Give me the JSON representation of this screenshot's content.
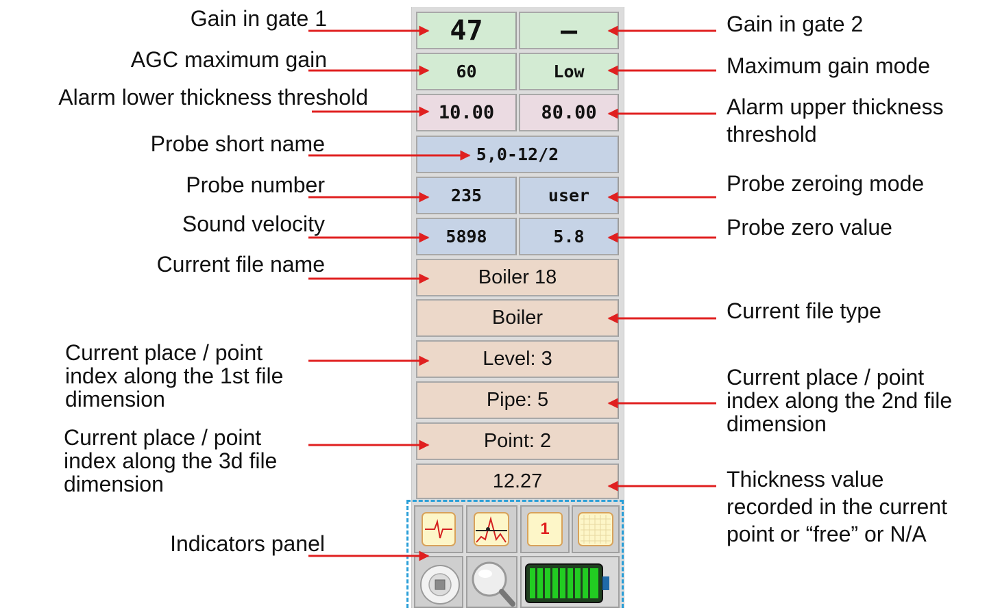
{
  "labels": {
    "gain_gate1": "Gain in gate 1",
    "agc_max_gain": "AGC maximum gain",
    "alarm_lower": "Alarm lower thickness threshold",
    "probe_short_name": "Probe short name",
    "probe_number": "Probe number",
    "sound_velocity": "Sound velocity",
    "current_file_name": "Current file name",
    "dim1": [
      "Current place / point",
      "index along the 1st file",
      "dimension"
    ],
    "dim3": [
      "Current place / point",
      "index along the 3d file",
      "dimension"
    ],
    "indicators_panel": "Indicators panel",
    "gain_gate2": "Gain in gate 2",
    "max_gain_mode": "Maximum gain mode",
    "alarm_upper": [
      "Alarm upper thickness",
      "threshold"
    ],
    "probe_zeroing_mode": "Probe zeroing mode",
    "probe_zero_value": "Probe zero value",
    "current_file_type": "Current file type",
    "dim2": [
      "Current place / point",
      "index along the 2nd  file",
      "dimension"
    ],
    "thickness_value": [
      "Thickness value",
      "recorded in the current",
      "point or “free” or N/A"
    ]
  },
  "panel": {
    "gain1": "47",
    "gain2": "–",
    "agc_max": "60",
    "gain_mode": "Low",
    "alarm_low": "10.00",
    "alarm_high": "80.00",
    "probe_name": "5,0-12/2",
    "probe_number": "235",
    "zero_mode": "user",
    "velocity": "5898",
    "zero_value": "5.8",
    "file_name": "Boiler 18",
    "file_type": "Boiler",
    "level": "Level: 3",
    "pipe": "Pipe: 5",
    "point": "Point: 2",
    "thickness": "12.27",
    "indicator_digit": "1"
  },
  "icons": {
    "ind1": "rf-signal-icon",
    "ind2": "envelope-signal-icon",
    "ind3": "channel-number-icon",
    "ind4": "grid-icon",
    "ind5": "stop-button-icon",
    "ind6": "magnifier-icon",
    "ind7": "battery-icon"
  },
  "colors": {
    "arrow": "#e02020",
    "gain_cells": "#d3ebd3",
    "alarm_cells": "#ebdbe2",
    "probe_cells": "#c6d3e6",
    "file_cells": "#ecd8c9",
    "indicator_bg": "#fdf6c8",
    "battery": "#22cc22",
    "dashed_frame": "#2a9fd8"
  }
}
